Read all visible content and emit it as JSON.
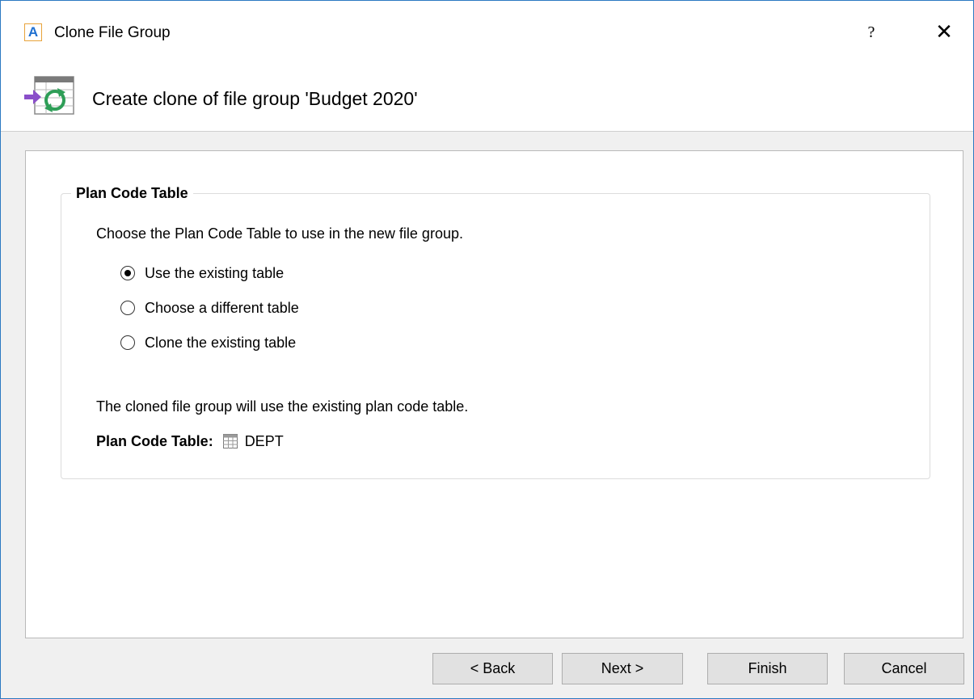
{
  "window": {
    "title": "Clone File Group",
    "app_icon_letter": "A",
    "help_symbol": "?",
    "close_symbol": "✕"
  },
  "header": {
    "text": "Create clone of file group 'Budget 2020'",
    "icon": "clone-file-group-icon"
  },
  "groupbox": {
    "legend": "Plan Code Table",
    "instruction": "Choose the Plan Code Table to use in the new file group.",
    "options": [
      {
        "label": "Use the existing table",
        "checked": true
      },
      {
        "label": "Choose a different table",
        "checked": false
      },
      {
        "label": "Clone the existing table",
        "checked": false
      }
    ],
    "description": "The cloned file group will use the existing plan code table.",
    "plan_code_label": "Plan Code Table:",
    "plan_code_value": "DEPT",
    "plan_code_icon": "table-grid-icon"
  },
  "buttons": {
    "back": "< Back",
    "next": "Next >",
    "finish": "Finish",
    "cancel": "Cancel"
  },
  "colors": {
    "window_border": "#2b79c2",
    "app_icon_letter": "#1e6fd0",
    "app_icon_border": "#e8a33b",
    "button_face": "#e1e1e1"
  }
}
